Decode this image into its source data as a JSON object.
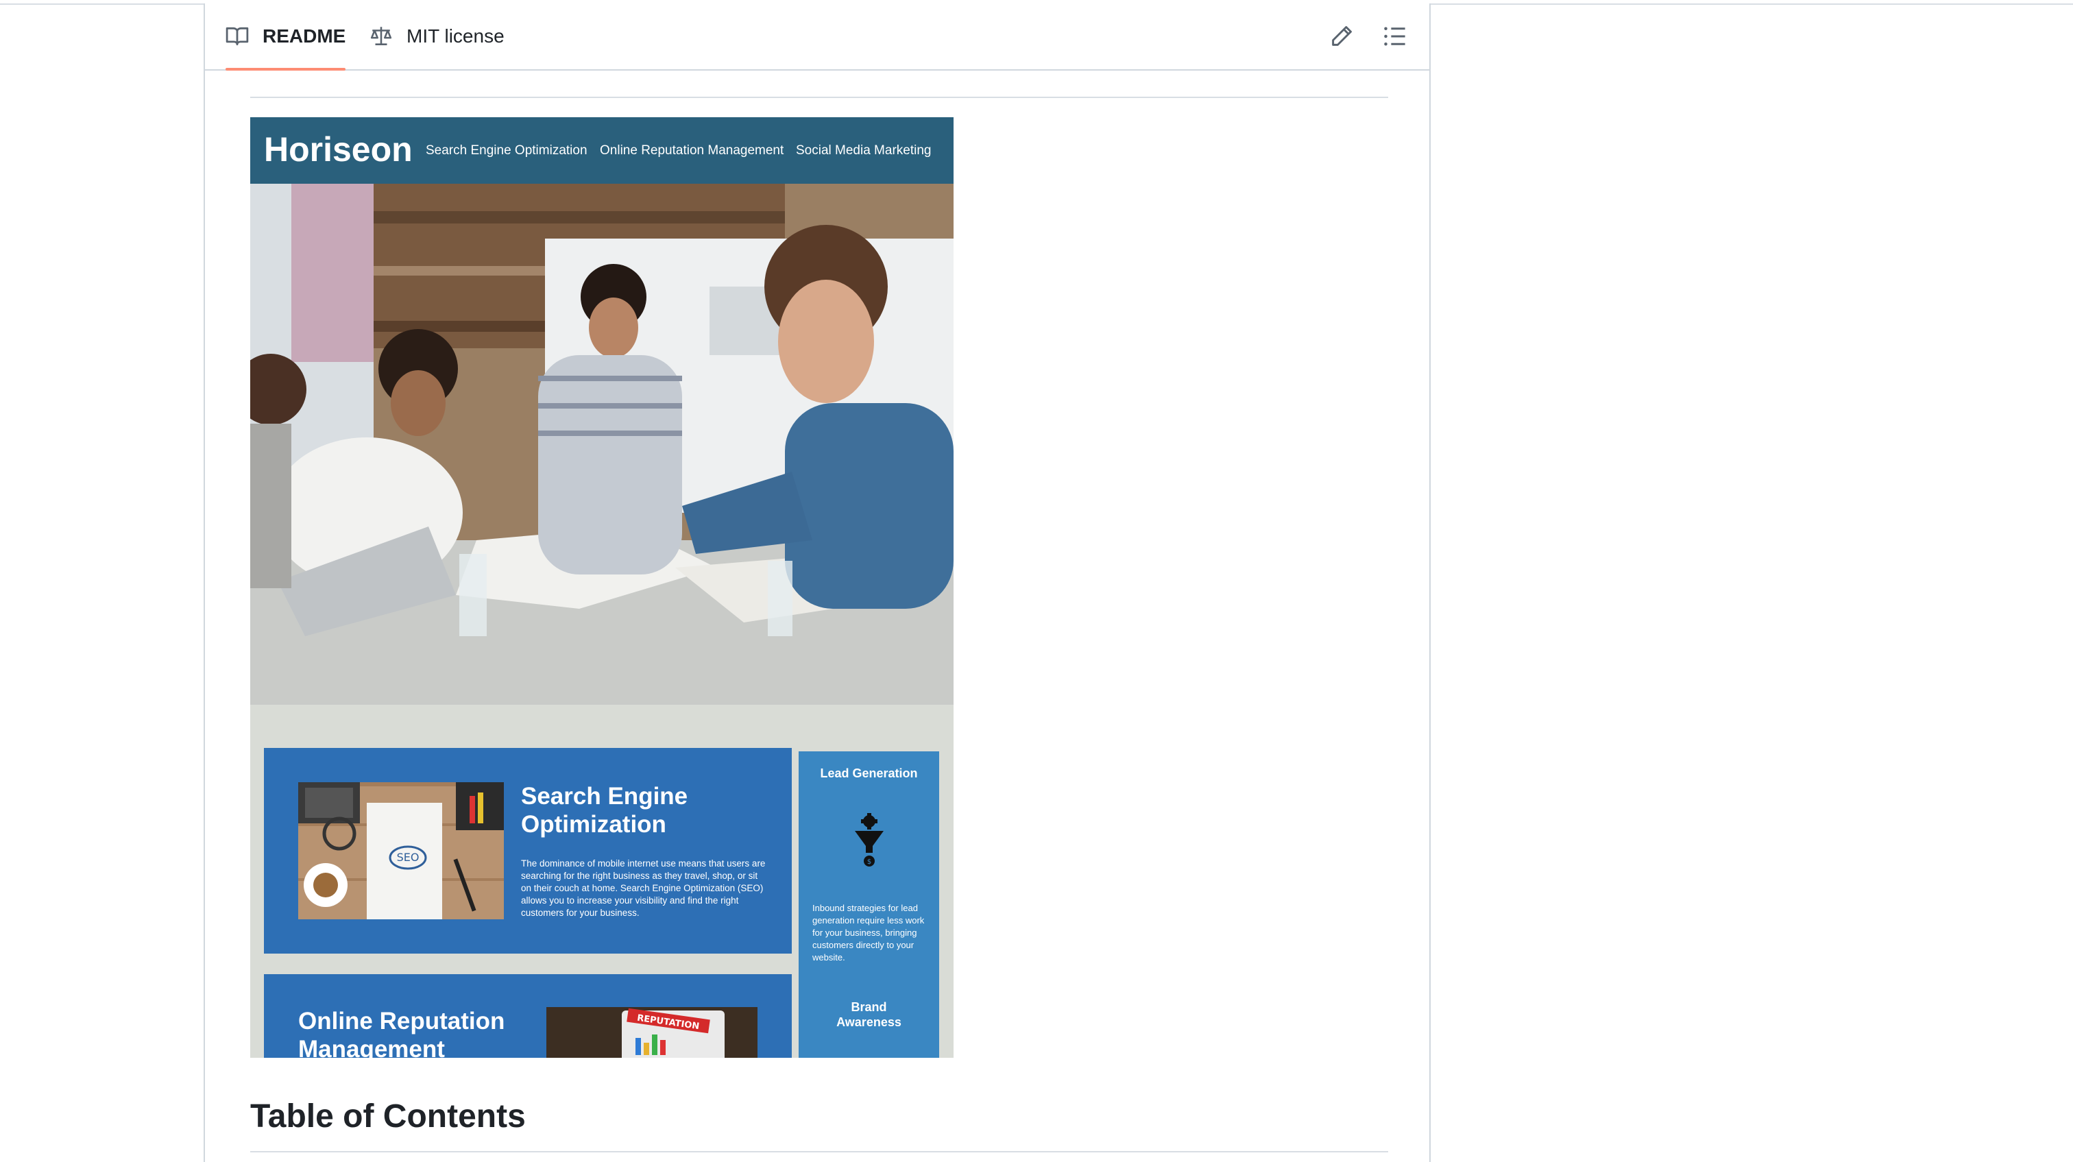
{
  "tabs": [
    {
      "label": "README",
      "icon": "book-icon",
      "active": true
    },
    {
      "label": "MIT license",
      "icon": "scale-icon",
      "active": false
    }
  ],
  "toolbar": {
    "edit_icon": "pencil-icon",
    "outline_icon": "list-icon"
  },
  "screenshot": {
    "logo": "Horiseon",
    "nav": [
      "Search Engine Optimization",
      "Online Reputation Management",
      "Social Media Marketing"
    ],
    "seo_card": {
      "title_line1": "Search Engine",
      "title_line2": "Optimization",
      "body": "The dominance of mobile internet use means that users are searching for the right business as they travel, shop, or sit on their couch at home. Search Engine Optimization (SEO) allows you to increase your visibility and find the right customers for your business.",
      "image_text": "SEO"
    },
    "orm_card": {
      "title_line1": "Online Reputation",
      "title_line2": "Management",
      "image_text": "REPUTATION"
    },
    "sidebar": {
      "lead_title": "Lead Generation",
      "lead_text": "Inbound strategies for lead generation require less work for your business, bringing customers directly to your website.",
      "brand_title_line1": "Brand",
      "brand_title_line2": "Awareness"
    }
  },
  "toc_heading": "Table of Contents",
  "colors": {
    "tab_underline": "#fd8c73",
    "header_blue": "#2a607c",
    "card_blue": "#2d6fb5",
    "side_blue": "#3a87c2"
  }
}
